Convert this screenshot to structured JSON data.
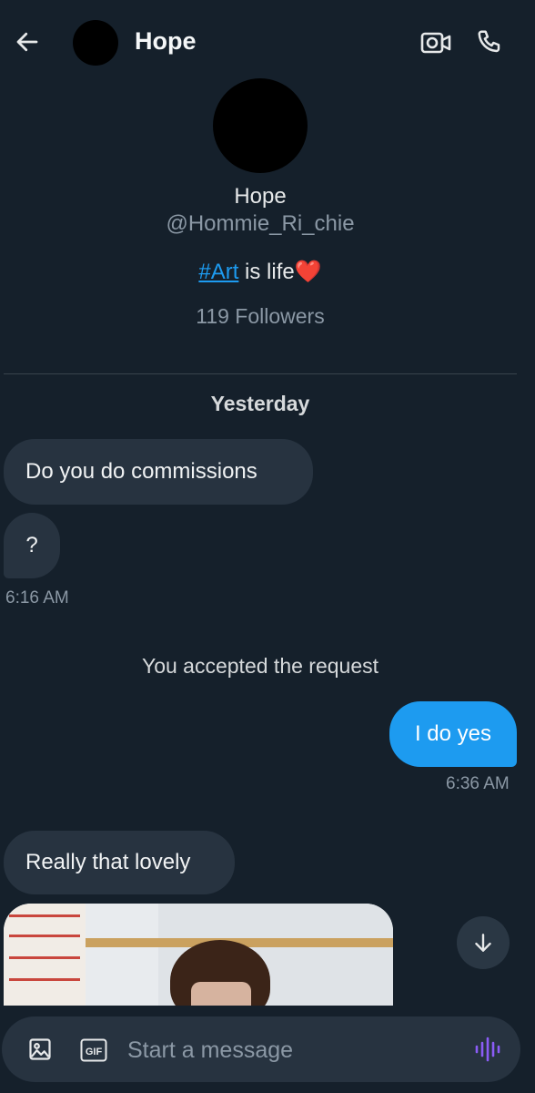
{
  "header": {
    "name": "Hope",
    "icons": {
      "back": "arrow-left-icon",
      "video": "video-call-icon",
      "phone": "phone-icon"
    }
  },
  "profile": {
    "name": "Hope",
    "handle": "@Hommie_Ri_chie",
    "bio_hashtag": "#Art",
    "bio_text": " is life",
    "bio_emoji": "❤️",
    "followers": "119 Followers"
  },
  "conversation": {
    "date_separator": "Yesterday",
    "messages": [
      {
        "text": "Do you do commissions",
        "direction": "incoming"
      },
      {
        "text": "?",
        "direction": "incoming"
      },
      {
        "time": "6:16 AM"
      },
      {
        "system": "You accepted the request"
      },
      {
        "text": "I do yes",
        "direction": "outgoing"
      },
      {
        "time": "6:36 AM"
      },
      {
        "text": "Really that lovely",
        "direction": "incoming"
      },
      {
        "type": "image"
      }
    ]
  },
  "composer": {
    "placeholder": "Start a message",
    "gif_label": "GIF"
  },
  "colors": {
    "background": "#15202b",
    "incoming_bubble": "#273340",
    "outgoing_bubble": "#1d9bf0",
    "accent": "#1d9bf0",
    "voice_icon": "#8b5cf6"
  }
}
